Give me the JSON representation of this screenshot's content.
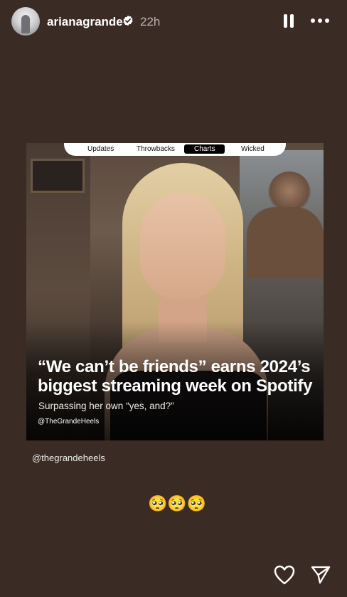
{
  "header": {
    "username": "arianagrande",
    "time": "22h"
  },
  "post": {
    "tabs": [
      "Updates",
      "Throwbacks",
      "Charts",
      "Wicked"
    ],
    "active_tab": "Charts",
    "headline": "“We can’t be friends” earns 2024’s biggest streaming week on Spotify",
    "subtitle": "Surpassing her own “yes, and?”",
    "handle": "@TheGrandeHeels"
  },
  "story": {
    "mention": "@thegrandeheels",
    "emojis": "🥺🥺🥺"
  },
  "colors": {
    "background": "#3a2b25",
    "text": "#ffffff"
  }
}
